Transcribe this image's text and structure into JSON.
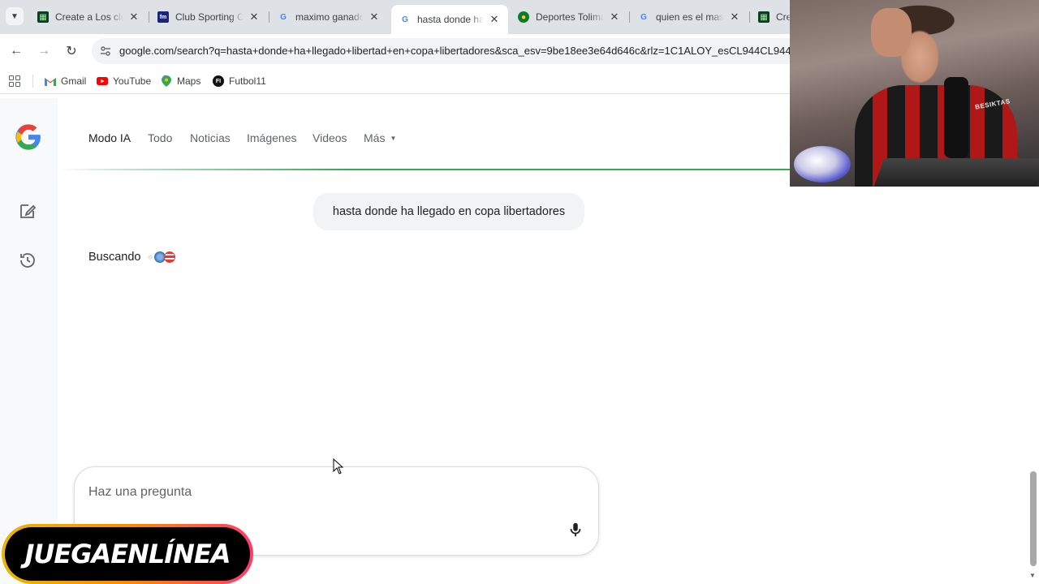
{
  "browser": {
    "tabs": [
      {
        "title": "Create a Los club",
        "favicon": "futbol11-green-icon",
        "active": false
      },
      {
        "title": "Club Sporting Cr",
        "favicon": "fm-icon",
        "active": false
      },
      {
        "title": "maximo ganado",
        "favicon": "google-icon",
        "active": false
      },
      {
        "title": "hasta donde ha",
        "favicon": "google-icon",
        "active": true
      },
      {
        "title": "Deportes Tolima",
        "favicon": "tolima-crest-icon",
        "active": false
      },
      {
        "title": "quien es el mas",
        "favicon": "google-icon",
        "active": false
      },
      {
        "title": "Cre",
        "favicon": "futbol11-green-icon",
        "active": false
      }
    ],
    "url": "google.com/search?q=hasta+donde+ha+llegado+libertad+en+copa+libertadores&sca_esv=9be18ee3e64d646c&rlz=1C1ALOY_esCL944CL944",
    "bookmarks": [
      {
        "label": "Gmail",
        "icon": "gmail-icon"
      },
      {
        "label": "YouTube",
        "icon": "youtube-icon"
      },
      {
        "label": "Maps",
        "icon": "maps-icon"
      },
      {
        "label": "Futbol11",
        "icon": "futbol11-icon"
      }
    ]
  },
  "search_tabs": [
    {
      "label": "Modo IA",
      "active": true
    },
    {
      "label": "Todo",
      "active": false
    },
    {
      "label": "Noticias",
      "active": false
    },
    {
      "label": "Imágenes",
      "active": false
    },
    {
      "label": "Videos",
      "active": false
    },
    {
      "label": "Más",
      "active": false
    }
  ],
  "conversation": {
    "user_query": "hasta donde ha llegado en copa libertadores",
    "status_text": "Buscando"
  },
  "composer": {
    "placeholder": "Haz una pregunta"
  },
  "overlay": {
    "brand_text": "JUEGAENLÍNEA",
    "webcam_sign": "BESIKTAS"
  },
  "colors": {
    "accent_green": "#34a853",
    "text_primary": "#202124",
    "text_secondary": "#5f6368"
  }
}
